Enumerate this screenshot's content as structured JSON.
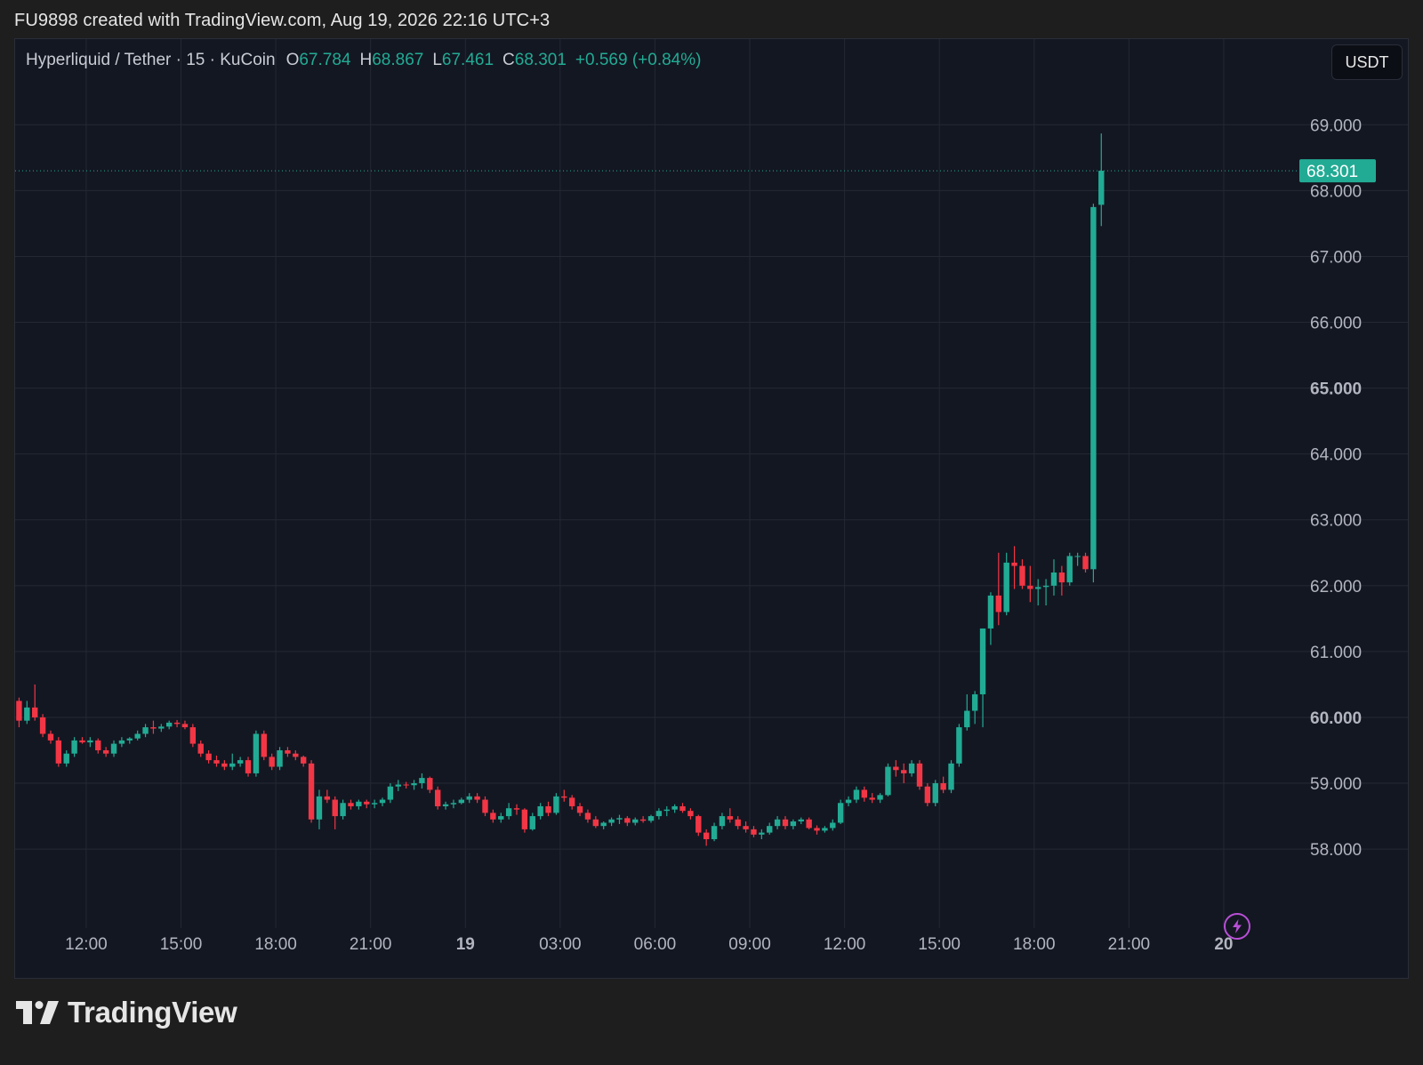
{
  "header": {
    "attribution": "FU9898 created with TradingView.com, Aug 19, 2026 22:16 UTC+3"
  },
  "legend": {
    "symbol": "Hyperliquid / Tether · 15 · KuCoin",
    "open_label": "O",
    "open": "67.784",
    "high_label": "H",
    "high": "68.867",
    "low_label": "L",
    "low": "67.461",
    "close_label": "C",
    "close": "68.301",
    "change": "+0.569 (+0.84%)"
  },
  "currency_button": "USDT",
  "footer": {
    "brand": "TradingView"
  },
  "colors": {
    "up": "#22ab94",
    "down": "#f23645",
    "background": "#131722",
    "grid": "#242833",
    "alert": "#b84fd6"
  },
  "icons": {
    "alert": "lightning-bolt-icon",
    "logo": "tradingview-logo-icon"
  },
  "chart_data": {
    "type": "candlestick",
    "title": "Hyperliquid / Tether · 15 · KuCoin",
    "interval_minutes": 15,
    "ylim": [
      56.8,
      70.3
    ],
    "y_ticks": [
      {
        "value": 58,
        "label": "58.000",
        "bold": false
      },
      {
        "value": 59,
        "label": "59.000",
        "bold": false
      },
      {
        "value": 60,
        "label": "60.000",
        "bold": true
      },
      {
        "value": 61,
        "label": "61.000",
        "bold": false
      },
      {
        "value": 62,
        "label": "62.000",
        "bold": false
      },
      {
        "value": 63,
        "label": "63.000",
        "bold": false
      },
      {
        "value": 64,
        "label": "64.000",
        "bold": false
      },
      {
        "value": 65,
        "label": "65.000",
        "bold": true
      },
      {
        "value": 66,
        "label": "66.000",
        "bold": false
      },
      {
        "value": 67,
        "label": "67.000",
        "bold": false
      },
      {
        "value": 68,
        "label": "68.000",
        "bold": false
      },
      {
        "value": 69,
        "label": "69.000",
        "bold": false
      }
    ],
    "x_ticks": [
      {
        "hour": 12,
        "label": "12:00",
        "bold": false
      },
      {
        "hour": 15,
        "label": "15:00",
        "bold": false
      },
      {
        "hour": 18,
        "label": "18:00",
        "bold": false
      },
      {
        "hour": 21,
        "label": "21:00",
        "bold": false
      },
      {
        "hour": 24,
        "label": "19",
        "bold": true
      },
      {
        "hour": 27,
        "label": "03:00",
        "bold": false
      },
      {
        "hour": 30,
        "label": "06:00",
        "bold": false
      },
      {
        "hour": 33,
        "label": "09:00",
        "bold": false
      },
      {
        "hour": 36,
        "label": "12:00",
        "bold": false
      },
      {
        "hour": 39,
        "label": "15:00",
        "bold": false
      },
      {
        "hour": 42,
        "label": "18:00",
        "bold": false
      },
      {
        "hour": 45,
        "label": "21:00",
        "bold": false
      },
      {
        "hour": 48,
        "label": "20",
        "bold": true
      }
    ],
    "xlim_hours": [
      9.75,
      50.0
    ],
    "last_price": {
      "value": 68.301,
      "label": "68.301"
    },
    "series": [
      [
        60.25,
        60.3,
        59.85,
        59.95
      ],
      [
        59.95,
        60.25,
        59.9,
        60.15
      ],
      [
        60.15,
        60.5,
        59.95,
        60.0
      ],
      [
        60.0,
        60.05,
        59.7,
        59.75
      ],
      [
        59.75,
        59.8,
        59.6,
        59.65
      ],
      [
        59.65,
        59.7,
        59.25,
        59.3
      ],
      [
        59.3,
        59.5,
        59.25,
        59.45
      ],
      [
        59.45,
        59.7,
        59.4,
        59.65
      ],
      [
        59.65,
        59.7,
        59.6,
        59.62
      ],
      [
        59.62,
        59.7,
        59.55,
        59.65
      ],
      [
        59.65,
        59.68,
        59.45,
        59.5
      ],
      [
        59.5,
        59.55,
        59.4,
        59.45
      ],
      [
        59.45,
        59.65,
        59.4,
        59.6
      ],
      [
        59.6,
        59.7,
        59.55,
        59.65
      ],
      [
        59.65,
        59.7,
        59.6,
        59.68
      ],
      [
        59.68,
        59.8,
        59.65,
        59.75
      ],
      [
        59.75,
        59.9,
        59.7,
        59.85
      ],
      [
        59.85,
        59.95,
        59.75,
        59.83
      ],
      [
        59.83,
        59.9,
        59.78,
        59.86
      ],
      [
        59.86,
        59.95,
        59.82,
        59.92
      ],
      [
        59.92,
        59.96,
        59.85,
        59.9
      ],
      [
        59.9,
        59.95,
        59.82,
        59.85
      ],
      [
        59.85,
        59.9,
        59.55,
        59.6
      ],
      [
        59.6,
        59.65,
        59.4,
        59.45
      ],
      [
        59.45,
        59.5,
        59.3,
        59.35
      ],
      [
        59.35,
        59.42,
        59.25,
        59.3
      ],
      [
        59.3,
        59.35,
        59.2,
        59.25
      ],
      [
        59.25,
        59.45,
        59.2,
        59.3
      ],
      [
        59.3,
        59.4,
        59.25,
        59.35
      ],
      [
        59.35,
        59.4,
        59.1,
        59.15
      ],
      [
        59.15,
        59.8,
        59.1,
        59.75
      ],
      [
        59.75,
        59.8,
        59.35,
        59.4
      ],
      [
        59.4,
        59.45,
        59.2,
        59.25
      ],
      [
        59.25,
        59.55,
        59.2,
        59.5
      ],
      [
        59.5,
        59.55,
        59.4,
        59.45
      ],
      [
        59.45,
        59.5,
        59.35,
        59.4
      ],
      [
        59.4,
        59.42,
        59.25,
        59.3
      ],
      [
        59.3,
        59.35,
        58.4,
        58.45
      ],
      [
        58.45,
        58.9,
        58.3,
        58.8
      ],
      [
        58.8,
        58.9,
        58.7,
        58.75
      ],
      [
        58.75,
        58.8,
        58.3,
        58.5
      ],
      [
        58.5,
        58.75,
        58.45,
        58.7
      ],
      [
        58.7,
        58.75,
        58.6,
        58.65
      ],
      [
        58.65,
        58.75,
        58.6,
        58.72
      ],
      [
        58.72,
        58.75,
        58.62,
        58.68
      ],
      [
        58.68,
        58.75,
        58.62,
        58.7
      ],
      [
        58.7,
        58.78,
        58.65,
        58.75
      ],
      [
        58.75,
        59.0,
        58.7,
        58.95
      ],
      [
        58.95,
        59.05,
        58.88,
        58.98
      ],
      [
        58.98,
        59.02,
        58.92,
        58.97
      ],
      [
        58.97,
        59.05,
        58.9,
        59.0
      ],
      [
        59.0,
        59.15,
        58.92,
        59.08
      ],
      [
        59.08,
        59.1,
        58.85,
        58.9
      ],
      [
        58.9,
        58.95,
        58.6,
        58.65
      ],
      [
        58.65,
        58.72,
        58.6,
        58.68
      ],
      [
        58.68,
        58.75,
        58.62,
        58.7
      ],
      [
        58.7,
        58.78,
        58.68,
        58.75
      ],
      [
        58.75,
        58.85,
        58.7,
        58.8
      ],
      [
        58.8,
        58.85,
        58.7,
        58.75
      ],
      [
        58.75,
        58.8,
        58.5,
        58.55
      ],
      [
        58.55,
        58.6,
        58.4,
        58.45
      ],
      [
        58.45,
        58.55,
        58.4,
        58.5
      ],
      [
        58.5,
        58.7,
        58.45,
        58.62
      ],
      [
        58.62,
        58.68,
        58.52,
        58.6
      ],
      [
        58.6,
        58.62,
        58.25,
        58.3
      ],
      [
        58.3,
        58.55,
        58.28,
        58.5
      ],
      [
        58.5,
        58.7,
        58.45,
        58.65
      ],
      [
        58.65,
        58.72,
        58.5,
        58.55
      ],
      [
        58.55,
        58.85,
        58.52,
        58.8
      ],
      [
        58.8,
        58.9,
        58.72,
        58.78
      ],
      [
        58.78,
        58.82,
        58.6,
        58.65
      ],
      [
        58.65,
        58.7,
        58.5,
        58.55
      ],
      [
        58.55,
        58.6,
        58.4,
        58.45
      ],
      [
        58.45,
        58.5,
        58.32,
        58.35
      ],
      [
        58.35,
        58.42,
        58.3,
        58.4
      ],
      [
        58.4,
        58.48,
        58.35,
        58.45
      ],
      [
        58.45,
        58.52,
        58.38,
        58.47
      ],
      [
        58.47,
        58.5,
        58.35,
        58.4
      ],
      [
        58.4,
        58.48,
        58.36,
        58.45
      ],
      [
        58.45,
        58.5,
        58.4,
        58.43
      ],
      [
        58.43,
        58.52,
        58.4,
        58.5
      ],
      [
        58.5,
        58.62,
        58.45,
        58.58
      ],
      [
        58.58,
        58.65,
        58.5,
        58.6
      ],
      [
        58.6,
        58.68,
        58.55,
        58.65
      ],
      [
        58.65,
        58.7,
        58.55,
        58.58
      ],
      [
        58.58,
        58.62,
        58.45,
        58.5
      ],
      [
        58.5,
        58.52,
        58.2,
        58.25
      ],
      [
        58.25,
        58.3,
        58.05,
        58.15
      ],
      [
        58.15,
        58.4,
        58.12,
        58.35
      ],
      [
        58.35,
        58.55,
        58.3,
        58.5
      ],
      [
        58.5,
        58.62,
        58.4,
        58.45
      ],
      [
        58.45,
        58.5,
        58.3,
        58.35
      ],
      [
        58.35,
        58.42,
        58.25,
        58.3
      ],
      [
        58.3,
        58.35,
        58.18,
        58.22
      ],
      [
        58.22,
        58.3,
        58.15,
        58.25
      ],
      [
        58.25,
        58.4,
        58.22,
        58.35
      ],
      [
        58.35,
        58.5,
        58.3,
        58.45
      ],
      [
        58.45,
        58.5,
        58.3,
        58.35
      ],
      [
        58.35,
        58.45,
        58.3,
        58.42
      ],
      [
        58.42,
        58.48,
        58.38,
        58.45
      ],
      [
        58.45,
        58.48,
        58.3,
        58.32
      ],
      [
        58.32,
        58.36,
        58.22,
        58.28
      ],
      [
        58.28,
        58.35,
        58.25,
        58.32
      ],
      [
        58.32,
        58.45,
        58.28,
        58.4
      ],
      [
        58.4,
        58.75,
        58.38,
        58.7
      ],
      [
        58.7,
        58.8,
        58.65,
        58.75
      ],
      [
        58.75,
        58.95,
        58.7,
        58.9
      ],
      [
        58.9,
        58.95,
        58.72,
        58.78
      ],
      [
        58.78,
        58.85,
        58.7,
        58.75
      ],
      [
        58.75,
        58.85,
        58.7,
        58.82
      ],
      [
        58.82,
        59.3,
        58.8,
        59.25
      ],
      [
        59.25,
        59.35,
        59.1,
        59.2
      ],
      [
        59.2,
        59.3,
        59.0,
        59.15
      ],
      [
        59.15,
        59.35,
        59.1,
        59.3
      ],
      [
        59.3,
        59.35,
        58.9,
        58.95
      ],
      [
        58.95,
        59.0,
        58.65,
        58.7
      ],
      [
        58.7,
        59.05,
        58.65,
        59.0
      ],
      [
        59.0,
        59.1,
        58.85,
        58.9
      ],
      [
        58.9,
        59.35,
        58.85,
        59.3
      ],
      [
        59.3,
        59.9,
        59.25,
        59.85
      ],
      [
        59.85,
        60.35,
        59.8,
        60.1
      ],
      [
        60.1,
        60.4,
        59.9,
        60.35
      ],
      [
        60.35,
        61.35,
        59.85,
        61.35
      ],
      [
        61.35,
        61.9,
        61.1,
        61.85
      ],
      [
        61.85,
        62.5,
        61.4,
        61.6
      ],
      [
        61.6,
        62.5,
        61.55,
        62.35
      ],
      [
        62.35,
        62.6,
        61.95,
        62.3
      ],
      [
        62.3,
        62.4,
        61.95,
        62.0
      ],
      [
        62.0,
        62.3,
        61.75,
        61.95
      ],
      [
        61.95,
        62.1,
        61.7,
        61.98
      ],
      [
        61.98,
        62.1,
        61.7,
        62.0
      ],
      [
        62.0,
        62.4,
        61.85,
        62.2
      ],
      [
        62.2,
        62.3,
        61.85,
        62.05
      ],
      [
        62.05,
        62.5,
        62.0,
        62.45
      ],
      [
        62.45,
        62.5,
        62.3,
        62.45
      ],
      [
        62.45,
        62.5,
        62.2,
        62.25
      ],
      [
        62.25,
        67.8,
        62.05,
        67.75
      ],
      [
        67.784,
        68.867,
        67.461,
        68.301
      ]
    ]
  }
}
